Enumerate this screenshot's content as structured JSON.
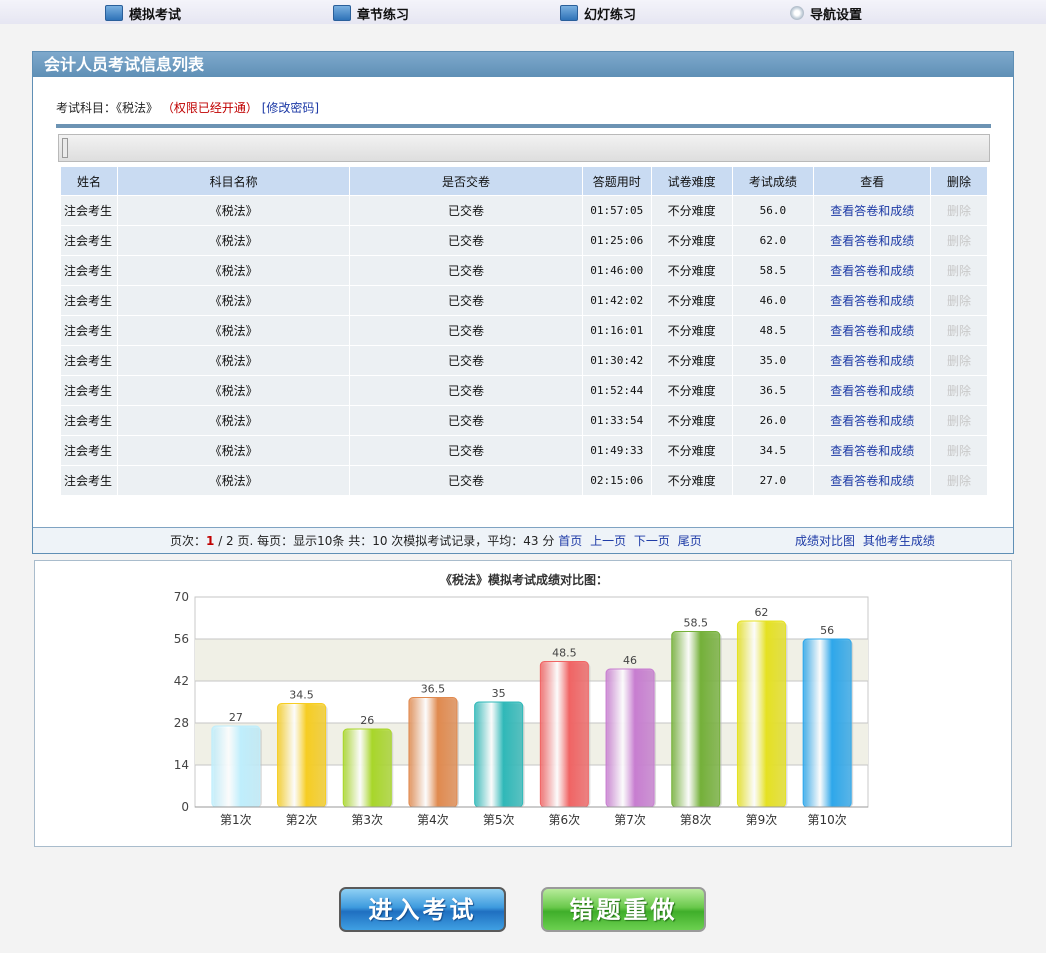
{
  "nav": {
    "items": [
      {
        "label": "模拟考试",
        "icon": "exam-icon"
      },
      {
        "label": "章节练习",
        "icon": "chapter-icon"
      },
      {
        "label": "幻灯练习",
        "icon": "slide-icon"
      },
      {
        "label": "导航设置",
        "icon": "gear-icon"
      }
    ]
  },
  "panel": {
    "title": "会计人员考试信息列表",
    "subject_label": "考试科目：《税法》",
    "permission": "（权限已经开通）",
    "change_password": "[修改密码]"
  },
  "table": {
    "headers": [
      "姓名",
      "科目名称",
      "是否交卷",
      "答题用时",
      "试卷难度",
      "考试成绩",
      "查看",
      "删除"
    ],
    "rows": [
      {
        "name": "注会考生",
        "subject": "《税法》",
        "submitted": "已交卷",
        "time": "01:57:05",
        "difficulty": "不分难度",
        "score": "56.0",
        "view": "查看答卷和成绩",
        "del": "删除"
      },
      {
        "name": "注会考生",
        "subject": "《税法》",
        "submitted": "已交卷",
        "time": "01:25:06",
        "difficulty": "不分难度",
        "score": "62.0",
        "view": "查看答卷和成绩",
        "del": "删除"
      },
      {
        "name": "注会考生",
        "subject": "《税法》",
        "submitted": "已交卷",
        "time": "01:46:00",
        "difficulty": "不分难度",
        "score": "58.5",
        "view": "查看答卷和成绩",
        "del": "删除"
      },
      {
        "name": "注会考生",
        "subject": "《税法》",
        "submitted": "已交卷",
        "time": "01:42:02",
        "difficulty": "不分难度",
        "score": "46.0",
        "view": "查看答卷和成绩",
        "del": "删除"
      },
      {
        "name": "注会考生",
        "subject": "《税法》",
        "submitted": "已交卷",
        "time": "01:16:01",
        "difficulty": "不分难度",
        "score": "48.5",
        "view": "查看答卷和成绩",
        "del": "删除"
      },
      {
        "name": "注会考生",
        "subject": "《税法》",
        "submitted": "已交卷",
        "time": "01:30:42",
        "difficulty": "不分难度",
        "score": "35.0",
        "view": "查看答卷和成绩",
        "del": "删除"
      },
      {
        "name": "注会考生",
        "subject": "《税法》",
        "submitted": "已交卷",
        "time": "01:52:44",
        "difficulty": "不分难度",
        "score": "36.5",
        "view": "查看答卷和成绩",
        "del": "删除"
      },
      {
        "name": "注会考生",
        "subject": "《税法》",
        "submitted": "已交卷",
        "time": "01:33:54",
        "difficulty": "不分难度",
        "score": "26.0",
        "view": "查看答卷和成绩",
        "del": "删除"
      },
      {
        "name": "注会考生",
        "subject": "《税法》",
        "submitted": "已交卷",
        "time": "01:49:33",
        "difficulty": "不分难度",
        "score": "34.5",
        "view": "查看答卷和成绩",
        "del": "删除"
      },
      {
        "name": "注会考生",
        "subject": "《税法》",
        "submitted": "已交卷",
        "time": "02:15:06",
        "difficulty": "不分难度",
        "score": "27.0",
        "view": "查看答卷和成绩",
        "del": "删除"
      }
    ]
  },
  "pager": {
    "page_prefix": "页次：",
    "current": "1",
    "page_rest": " / 2 页. 每页：显示10条 共：10 次模拟考试记录，平均：43 分",
    "first": "首页",
    "prev": "上一页",
    "next": "下一页",
    "last": "尾页",
    "compare": "成绩对比图",
    "others": "其他考生成绩"
  },
  "chart_data": {
    "type": "bar",
    "title": "《税法》模拟考试成绩对比图：",
    "categories": [
      "第1次",
      "第2次",
      "第3次",
      "第4次",
      "第5次",
      "第6次",
      "第7次",
      "第8次",
      "第9次",
      "第10次"
    ],
    "values": [
      27,
      34.5,
      26,
      36.5,
      35,
      48.5,
      46,
      58.5,
      62,
      56
    ],
    "value_labels": [
      "27",
      "34.5",
      "26",
      "36.5",
      "35",
      "48.5",
      "46",
      "58.5",
      "62",
      "56"
    ],
    "yticks": [
      "0",
      "14",
      "28",
      "42",
      "56",
      "70"
    ],
    "ylim": [
      0,
      70
    ],
    "colors": [
      "#bfeefc",
      "#f6cd22",
      "#a8d62a",
      "#e08a4f",
      "#2fb8b8",
      "#f06464",
      "#c77dd0",
      "#74b039",
      "#e5e122",
      "#2ea7ea"
    ]
  },
  "buttons": {
    "enter": "进入考试",
    "redo": "错题重做"
  }
}
